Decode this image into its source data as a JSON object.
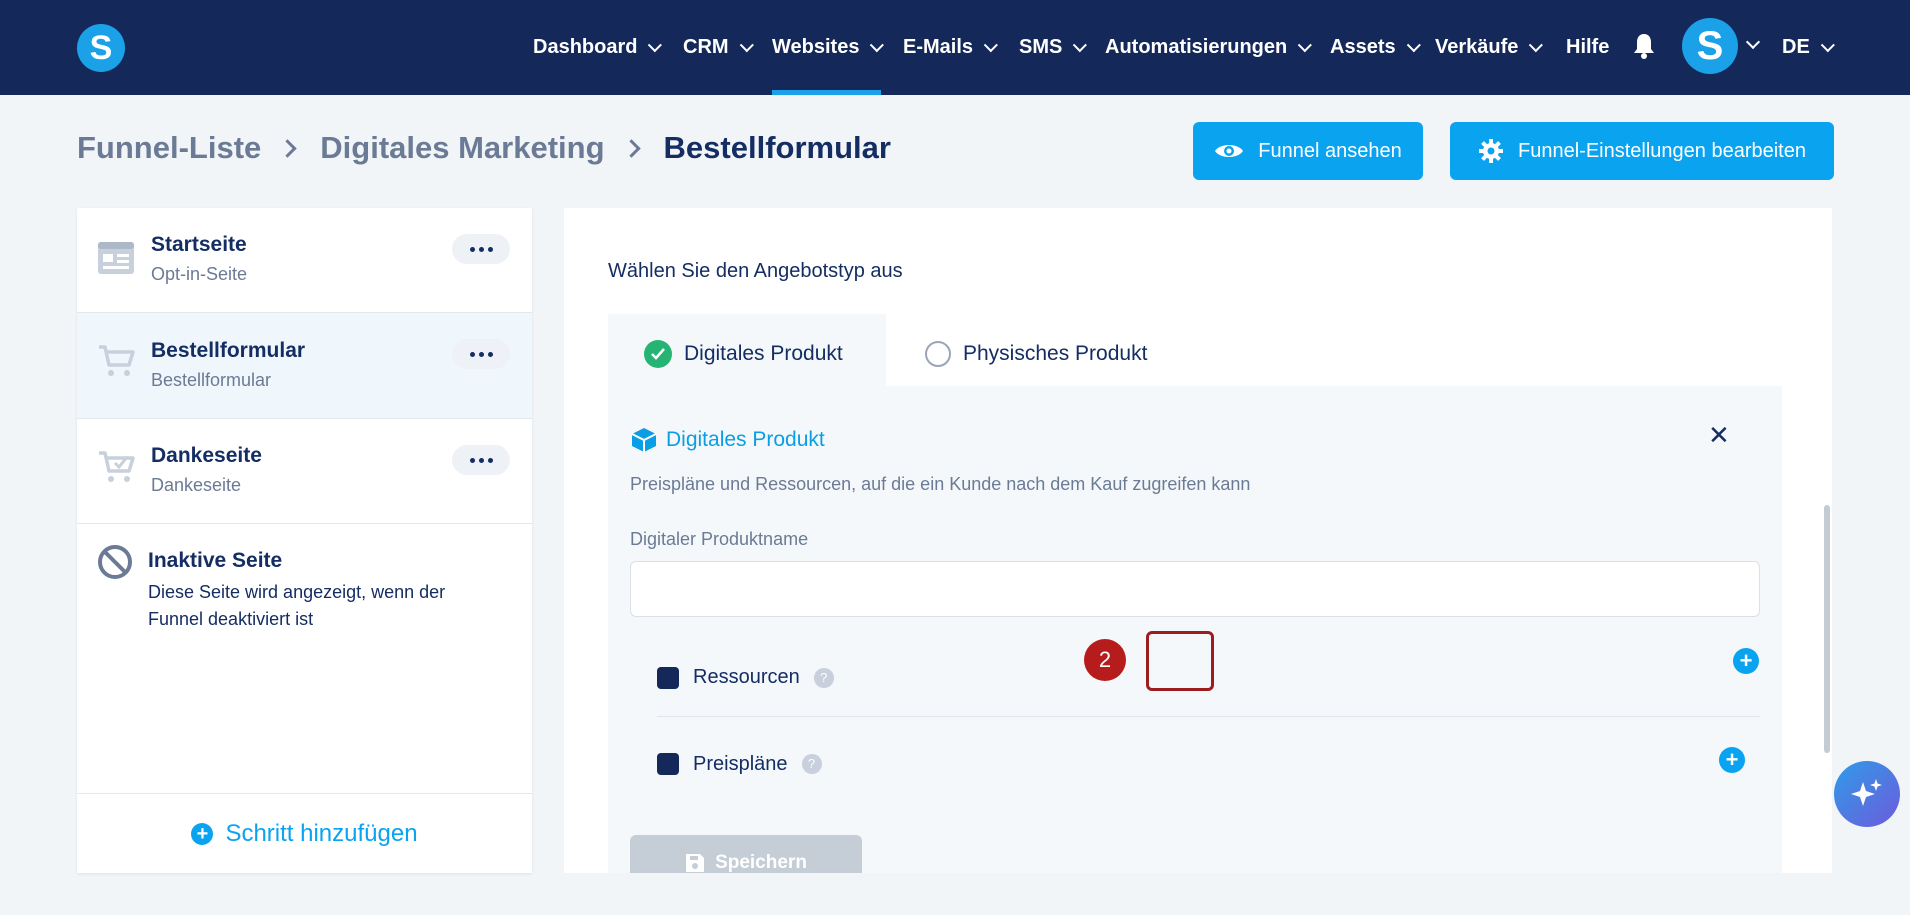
{
  "app": {
    "logo_letter": "S"
  },
  "nav": {
    "items": [
      {
        "label": "Dashboard"
      },
      {
        "label": "CRM"
      },
      {
        "label": "Websites",
        "active": true
      },
      {
        "label": "E-Mails"
      },
      {
        "label": "SMS"
      },
      {
        "label": "Automatisierungen"
      },
      {
        "label": "Assets"
      },
      {
        "label": "Verkäufe"
      },
      {
        "label": "Hilfe"
      }
    ],
    "avatar_letter": "S",
    "language": "DE"
  },
  "breadcrumb": {
    "items": [
      "Funnel-Liste",
      "Digitales Marketing",
      "Bestellformular"
    ]
  },
  "header_buttons": {
    "view_funnel": "Funnel ansehen",
    "edit_settings": "Funnel-Einstellungen bearbeiten"
  },
  "sidebar": {
    "steps": [
      {
        "title": "Startseite",
        "subtitle": "Opt-in-Seite",
        "icon": "webpage-icon"
      },
      {
        "title": "Bestellformular",
        "subtitle": "Bestellformular",
        "icon": "cart-icon",
        "active": true
      },
      {
        "title": "Dankeseite",
        "subtitle": "Dankeseite",
        "icon": "cart-check-icon"
      }
    ],
    "inactive": {
      "title": "Inaktive Seite",
      "description": "Diese Seite wird angezeigt, wenn der Funnel deaktiviert ist"
    },
    "add_step_label": "Schritt hinzufügen"
  },
  "main": {
    "offer_type_label": "Wählen Sie den Angebotstyp aus",
    "tabs": [
      {
        "label": "Digitales Produkt",
        "selected": true
      },
      {
        "label": "Physisches Produkt",
        "selected": false
      }
    ],
    "card": {
      "title": "Digitales Produkt",
      "description": "Preispläne und Ressourcen, auf die ein Kunde nach dem Kauf zugreifen kann",
      "field_label": "Digitaler Produktname",
      "field_value": "",
      "resources_label": "Ressourcen",
      "pricing_label": "Preispläne",
      "help_mark": "?",
      "save_label": "Speichern"
    },
    "annotation_badge": "2"
  },
  "colors": {
    "nav_bg": "#14295a",
    "accent": "#0aa3f0",
    "annotation": "#b71c1c",
    "success": "#25b473"
  }
}
